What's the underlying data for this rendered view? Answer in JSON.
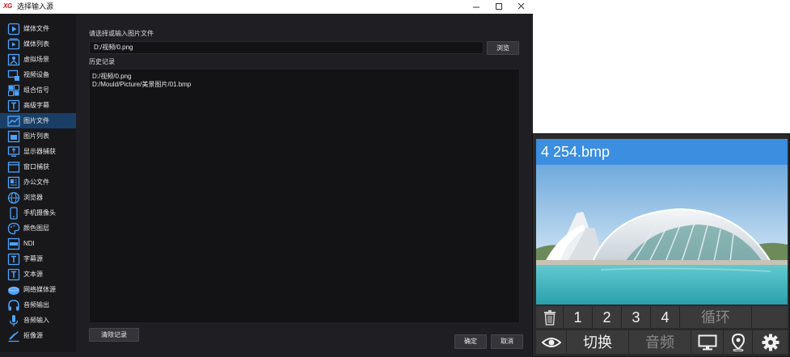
{
  "window": {
    "logo": "XG",
    "title": "选择输入源",
    "controls": {
      "minimize": "—",
      "maximize": "☐",
      "close": "✕"
    }
  },
  "sidebar": {
    "items": [
      {
        "label": "媒体文件",
        "icon": "play-icon"
      },
      {
        "label": "媒体列表",
        "icon": "playlist-icon"
      },
      {
        "label": "虚拟场景",
        "icon": "virtual-scene-icon"
      },
      {
        "label": "视频设备",
        "icon": "video-device-icon"
      },
      {
        "label": "组合信号",
        "icon": "grid-icon"
      },
      {
        "label": "高级字幕",
        "icon": "text-icon"
      },
      {
        "label": "图片文件",
        "icon": "image-file-icon",
        "active": true
      },
      {
        "label": "图片列表",
        "icon": "image-list-icon"
      },
      {
        "label": "显示器捕获",
        "icon": "monitor-capture-icon"
      },
      {
        "label": "窗口捕获",
        "icon": "window-capture-icon"
      },
      {
        "label": "办公文件",
        "icon": "office-file-icon"
      },
      {
        "label": "浏览器",
        "icon": "globe-icon"
      },
      {
        "label": "手机摄像头",
        "icon": "phone-icon"
      },
      {
        "label": "颜色图层",
        "icon": "palette-icon"
      },
      {
        "label": "NDI",
        "icon": "ndi-icon"
      },
      {
        "label": "字幕源",
        "icon": "text-icon"
      },
      {
        "label": "文本源",
        "icon": "text-icon"
      },
      {
        "label": "网络媒体源",
        "icon": "network-media-icon"
      },
      {
        "label": "音频输出",
        "icon": "headphones-icon"
      },
      {
        "label": "音频输入",
        "icon": "microphone-icon"
      },
      {
        "label": "抠像源",
        "icon": "keying-icon"
      }
    ]
  },
  "main": {
    "path_label": "请选择或输入图片文件",
    "path_value": "D:/视频/0.png",
    "browse_label": "浏览",
    "history_label": "历史记录",
    "history": [
      "D:/视频/0.png",
      "D:/Mould/Picture/美景图片/01.bmp"
    ],
    "clear_label": "清除记录",
    "ok_label": "确定",
    "cancel_label": "取消"
  },
  "preview": {
    "title": "4 254.bmp",
    "header_color": "#3b8ee0",
    "row1": {
      "trash_icon": "trash-icon",
      "slots": [
        "1",
        "2",
        "3",
        "4"
      ],
      "loop_label": "循环"
    },
    "row2": {
      "eye_icon": "eye-icon",
      "switch_label": "切换",
      "audio_label": "音频",
      "monitor_icon": "monitor-icon",
      "location_icon": "location-pin-icon",
      "settings_icon": "gear-icon"
    }
  }
}
